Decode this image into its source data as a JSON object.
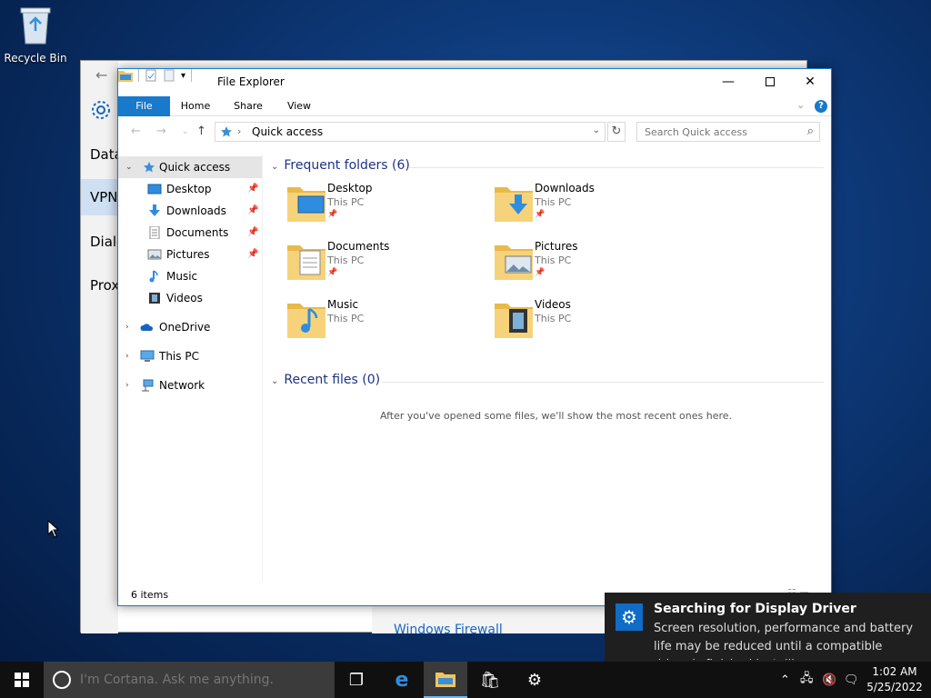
{
  "desktop": {
    "recycle_bin_label": "Recycle Bin"
  },
  "settings_window": {
    "nav_items": [
      "Data",
      "VPN",
      "Dial-",
      "Proxy"
    ],
    "link_windows_firewall": "Windows Firewall"
  },
  "explorer": {
    "title": "File Explorer",
    "ribbon_tabs": [
      "File",
      "Home",
      "Share",
      "View"
    ],
    "address": "Quick access",
    "search_placeholder": "Search Quick access",
    "nav": {
      "quick_access": "Quick access",
      "quick_items": [
        "Desktop",
        "Downloads",
        "Documents",
        "Pictures",
        "Music",
        "Videos"
      ],
      "onedrive": "OneDrive",
      "this_pc": "This PC",
      "network": "Network"
    },
    "frequent_header": "Frequent folders (6)",
    "folders": [
      {
        "name": "Desktop",
        "location": "This PC",
        "icon": "desktop-folder-icon"
      },
      {
        "name": "Downloads",
        "location": "This PC",
        "icon": "downloads-folder-icon"
      },
      {
        "name": "Documents",
        "location": "This PC",
        "icon": "documents-folder-icon"
      },
      {
        "name": "Pictures",
        "location": "This PC",
        "icon": "pictures-folder-icon"
      },
      {
        "name": "Music",
        "location": "This PC",
        "icon": "music-folder-icon"
      },
      {
        "name": "Videos",
        "location": "This PC",
        "icon": "videos-folder-icon"
      }
    ],
    "recent_header": "Recent files (0)",
    "recent_empty": "After you've opened some files, we'll show the most recent ones here.",
    "status": "6 items"
  },
  "toast": {
    "title": "Searching for Display Driver",
    "body": "Screen resolution, performance and battery life may be reduced until a compatible driver is finished installing."
  },
  "taskbar": {
    "cortana_placeholder": "I'm Cortana. Ask me anything.",
    "time": "1:02 AM",
    "date": "5/25/2022"
  },
  "colors": {
    "accent": "#1979ca",
    "folder": "#f2c55c",
    "taskbar": "#101010"
  }
}
